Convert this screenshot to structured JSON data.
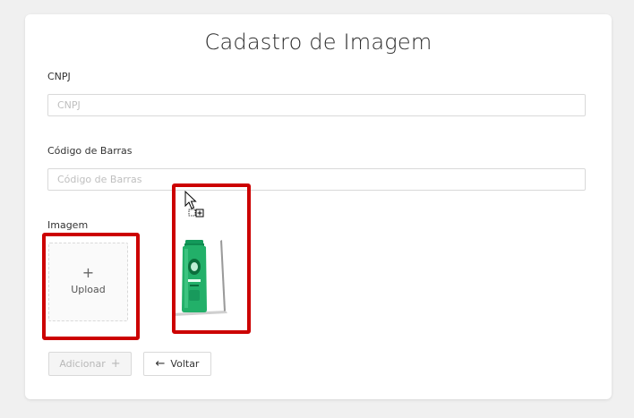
{
  "form": {
    "title": "Cadastro de Imagem",
    "cnpj_label": "CNPJ",
    "cnpj_placeholder": "CNPJ",
    "cnpj_value": "",
    "barcode_label": "Código de Barras",
    "barcode_placeholder": "Código de Barras",
    "barcode_value": "",
    "image_label": "Imagem",
    "upload_plus": "+",
    "upload_label": "Upload"
  },
  "actions": {
    "add_label": "Adicionar",
    "add_icon": "+",
    "back_icon": "←",
    "back_label": "Voltar"
  },
  "colors": {
    "highlight": "#cc0000",
    "card_background": "#ffffff",
    "page_background": "#f0f0f0"
  },
  "icons": {
    "upload": "plus-icon",
    "add": "plus-icon",
    "back": "arrow-left-icon",
    "cursor": "copy-cursor-icon"
  }
}
